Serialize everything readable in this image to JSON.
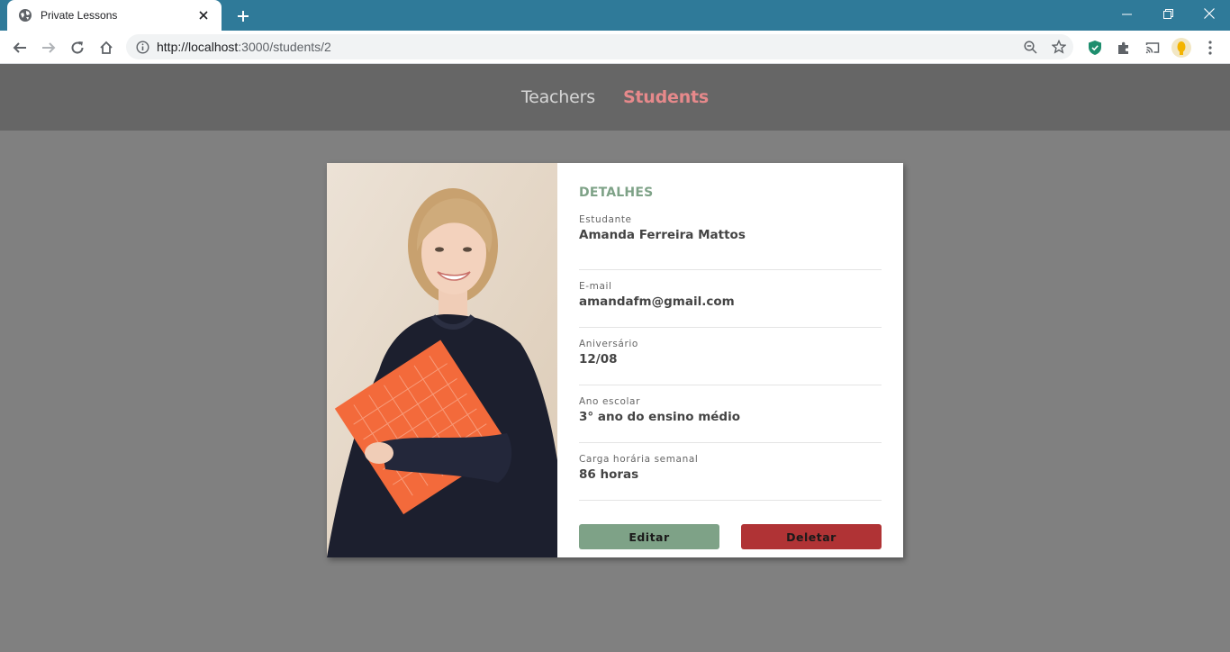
{
  "browser": {
    "tab_title": "Private Lessons",
    "url_host": "http://localhost",
    "url_rest": ":3000/students/2"
  },
  "nav": {
    "teachers": "Teachers",
    "students": "Students"
  },
  "details": {
    "heading": "DETALHES",
    "fields": [
      {
        "label": "Estudante",
        "value": "Amanda Ferreira Mattos"
      },
      {
        "label": "E-mail",
        "value": "amandafm@gmail.com"
      },
      {
        "label": "Aniversário",
        "value": "12/08"
      },
      {
        "label": "Ano escolar",
        "value": "3° ano do ensino médio"
      },
      {
        "label": "Carga horária semanal",
        "value": "86 horas"
      }
    ]
  },
  "actions": {
    "edit": "Editar",
    "delete": "Deletar"
  },
  "colors": {
    "accent_green": "#7ea287",
    "danger_red": "#b03335",
    "active_nav": "#e6898b",
    "tab_strip": "#2f7a99"
  }
}
